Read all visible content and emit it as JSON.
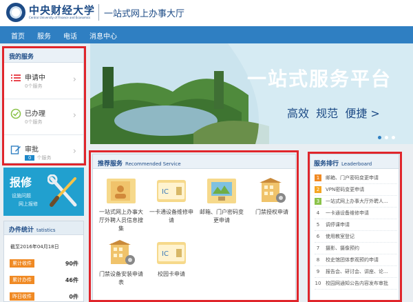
{
  "header": {
    "logo_cn": "中央财经大学",
    "logo_en": "Central University of Finance and Economics",
    "hall_title": "一站式网上办事大厅"
  },
  "nav": {
    "items": [
      "首页",
      "服务",
      "电话",
      "消息中心"
    ]
  },
  "my_services": {
    "title": "我的服务",
    "items": [
      {
        "label": "申请中",
        "count": "0个服务",
        "icon": "list-icon"
      },
      {
        "label": "已办理",
        "count": "0个服务",
        "icon": "check-circle-icon"
      },
      {
        "label": "审批",
        "badge": "0",
        "count": "个服务",
        "icon": "edit-icon"
      }
    ]
  },
  "repair": {
    "title": "报修",
    "sub1": "设施问题",
    "sub2": "网上报修"
  },
  "stats": {
    "title": "办件统计",
    "title_en": "tatistics",
    "date": "截至2016年04月18日",
    "rows": [
      {
        "label": "累计收件",
        "value": "90件"
      },
      {
        "label": "累计办件",
        "value": "46件"
      },
      {
        "label": "昨日收件",
        "value": "0件"
      }
    ]
  },
  "banner": {
    "title": "一站式服务平台",
    "slogan": "高效  规范  便捷 >",
    "dots": 3,
    "active_dot": 0
  },
  "recommended": {
    "title": "推荐服务",
    "title_en": "Recommended Service",
    "items": [
      {
        "label": "一站式网上办事大厅外聘人员信息搜集",
        "icon": "id-card-icon"
      },
      {
        "label": "一卡通设备维修申请",
        "icon": "ic-card-icon"
      },
      {
        "label": "邮箱、门户密码变更申请",
        "icon": "monitor-icon"
      },
      {
        "label": "门禁授权申请",
        "icon": "building-gear-icon"
      },
      {
        "label": "门禁设备安装申请表",
        "icon": "building-gear-icon"
      },
      {
        "label": "校园卡申请",
        "icon": "ic-card-icon"
      }
    ]
  },
  "ranking": {
    "title": "服务排行",
    "title_en": "Leaderboard",
    "items": [
      {
        "rank": "1",
        "label": "邮箱、门户密码变更申请"
      },
      {
        "rank": "2",
        "label": "VPN密码变更申请"
      },
      {
        "rank": "3",
        "label": "一站式网上办事大厅外聘人..."
      },
      {
        "rank": "4",
        "label": "一卡通设备维修申请"
      },
      {
        "rank": "5",
        "label": "调停课申请"
      },
      {
        "rank": "6",
        "label": "使用教室登记"
      },
      {
        "rank": "7",
        "label": "摄影、摄像预约"
      },
      {
        "rank": "8",
        "label": "校史馆团体参观预约申请"
      },
      {
        "rank": "9",
        "label": "报告会、研讨会、讲座、论..."
      },
      {
        "rank": "10",
        "label": "校园网通知公告内容发布审批"
      }
    ]
  },
  "colors": {
    "nav_blue": "#2f7fc2",
    "title_blue": "#1d4b86",
    "rank_top": [
      "#f08a24",
      "#f5a623",
      "#8bc34a"
    ],
    "stat_label": "#f08a24",
    "highlight_frame": "#e0252b"
  }
}
